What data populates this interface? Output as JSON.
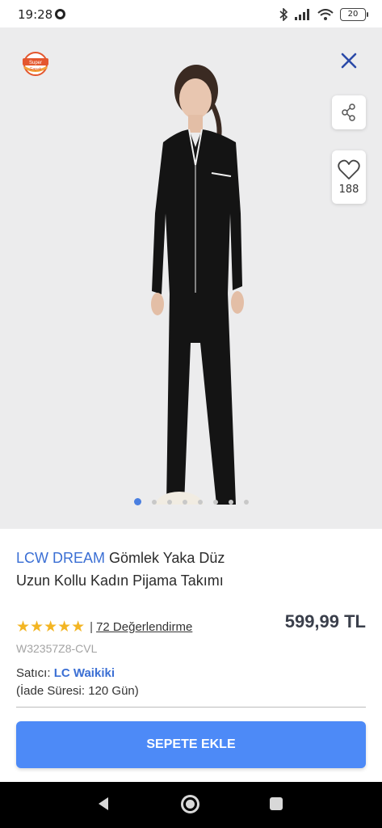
{
  "status": {
    "time": "19:28",
    "battery": "20"
  },
  "hero": {
    "badge_text_top": "Super",
    "badge_text_bottom": "Gapalı",
    "favorites_count": "188",
    "carousel_dots": 8,
    "carousel_active_index": 0
  },
  "product": {
    "brand": "LCW DREAM",
    "name": " Gömlek Yaka Düz Uzun Kollu Kadın Pijama Takımı",
    "stars": "★★★★★",
    "rating_separator": "|",
    "reviews": "72 Değerlendirme",
    "price": "599,99 TL",
    "sku": "W32357Z8-CVL",
    "seller_label": "Satıcı:",
    "seller_name": "LC Waikiki",
    "return_policy": "(İade Süresi: 120 Gün)"
  },
  "actions": {
    "add_to_cart": "SEPETE EKLE"
  },
  "colors": {
    "accent": "#4d8af7",
    "brand": "#3b6fd4",
    "stars": "#f3b523",
    "price": "#3a3f4b"
  }
}
